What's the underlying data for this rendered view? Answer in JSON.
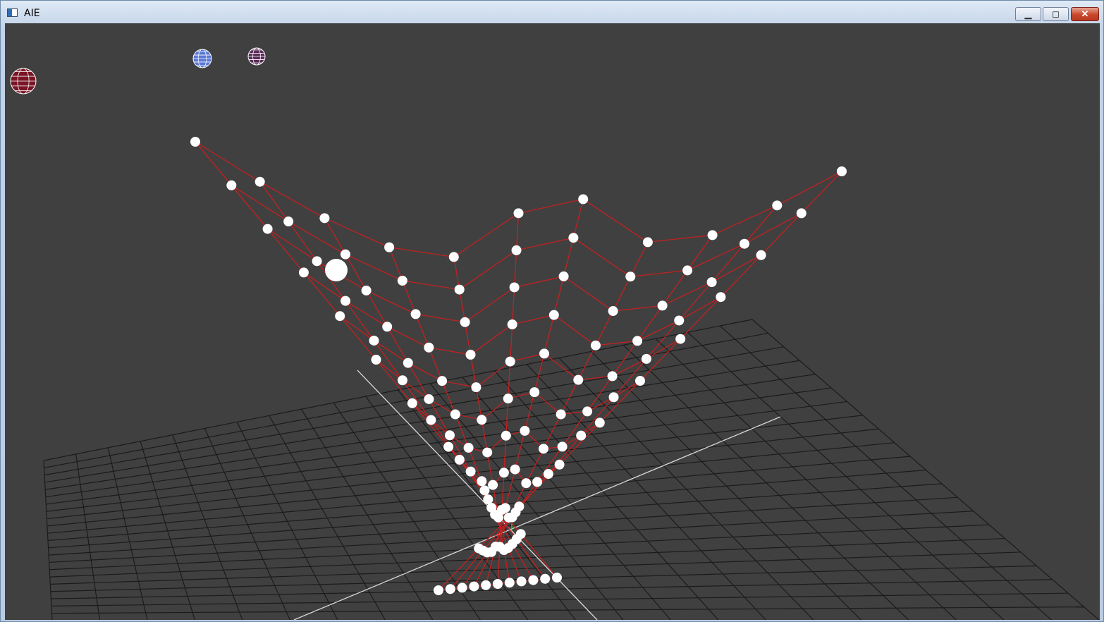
{
  "window": {
    "title": "AIE",
    "icon": "application-icon",
    "controls": [
      "minimize-icon",
      "maximize-icon",
      "close-icon"
    ],
    "control_glyphs": {
      "minimize": "▁",
      "maximize": "◻",
      "close": "✕"
    }
  },
  "viewport": {
    "background": "#404040",
    "grid_color": "#1b1b1b",
    "axis_color": "#d8d8d8",
    "y_axis_color": "#3fcf3f",
    "spring_color": "#c42020",
    "node_color": "#ffffff"
  },
  "gizmos": [
    {
      "name": "red-wire-sphere-icon",
      "color": "#7a1525"
    },
    {
      "name": "blue-wire-sphere-icon",
      "color": "#5b78d6"
    },
    {
      "name": "purple-wire-sphere-icon",
      "color": "#5a2c58"
    }
  ]
}
